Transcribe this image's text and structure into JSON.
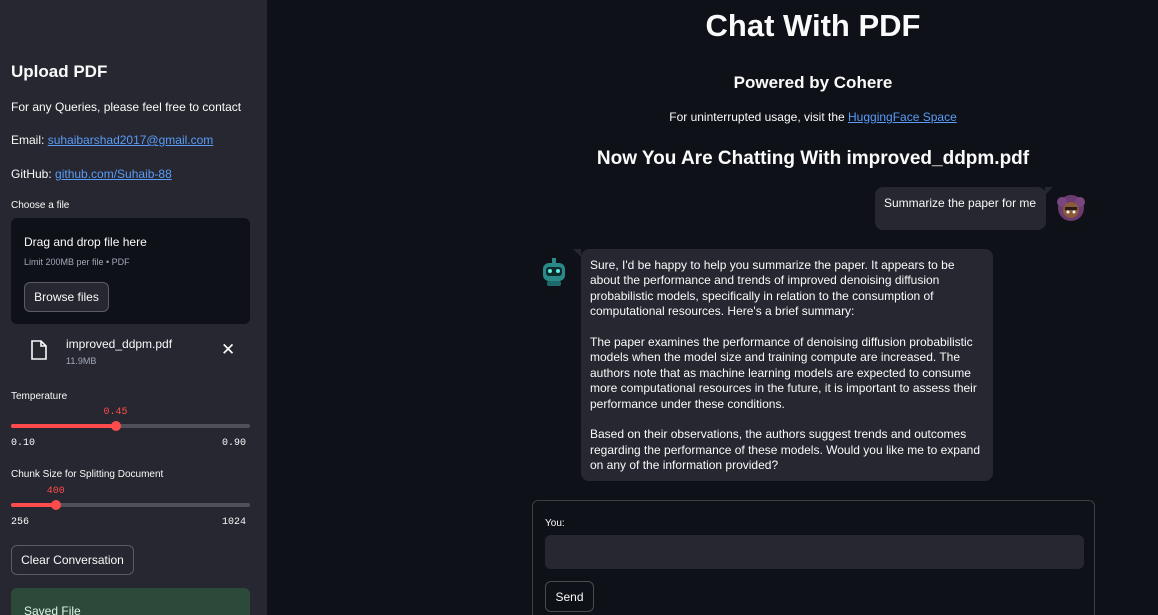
{
  "sidebar": {
    "title": "Upload PDF",
    "contact_text": "For any Queries, please feel free to contact",
    "email_label": "Email: ",
    "email": "suhaibarshad2017@gmail.com",
    "github_label": "GitHub: ",
    "github": "github.com/Suhaib-88",
    "uploader": {
      "label": "Choose a file",
      "drop_text": "Drag and drop file here",
      "limit_text": "Limit 200MB per file • PDF",
      "browse_label": "Browse files"
    },
    "file": {
      "name": "improved_ddpm.pdf",
      "size": "11.9MB",
      "icon": "file-icon",
      "remove_icon": "close-icon"
    },
    "temperature": {
      "label": "Temperature",
      "value": "0.45",
      "min": "0.10",
      "max": "0.90",
      "fraction": 0.4375
    },
    "chunk": {
      "label": "Chunk Size for Splitting Document",
      "value": "400",
      "min": "256",
      "max": "1024",
      "fraction": 0.1875
    },
    "clear_label": "Clear Conversation",
    "saved_label": "Saved File"
  },
  "main": {
    "title": "Chat With PDF",
    "subtitle": "Powered by Cohere",
    "note_prefix": "For uninterrupted usage, visit the ",
    "note_link": "HuggingFace Space",
    "chatting_title": "Now You Are Chatting With improved_ddpm.pdf"
  },
  "chat": {
    "user_message": "Summarize the paper for me",
    "bot_message": "Sure, I'd be happy to help you summarize the paper. It appears to be about the performance and trends of improved denoising diffusion probabilistic models, specifically in relation to the consumption of computational resources. Here's a brief summary:\n\nThe paper examines the performance of denoising diffusion probabilistic models when the model size and training compute are increased. The authors note that as machine learning models are expected to consume more computational resources in the future, it is important to assess their performance under these conditions.\n\nBased on their observations, the authors suggest trends and outcomes regarding the performance of these models. Would you like me to expand on any of the information provided?"
  },
  "form": {
    "input_label": "You:",
    "input_value": "",
    "send_label": "Send"
  },
  "colors": {
    "accent": "#ff4b4b",
    "link": "#5a9cf8",
    "background": "#0e1117",
    "sidebar": "#262730",
    "success": "#2c4a3a"
  }
}
